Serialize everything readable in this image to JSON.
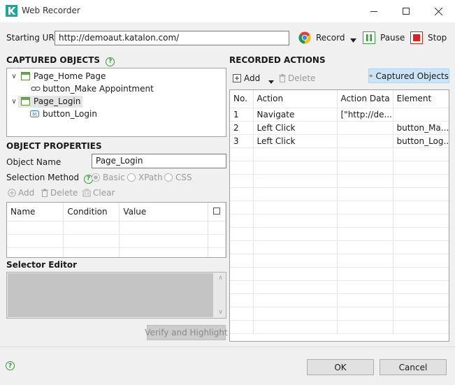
{
  "window": {
    "title": "Web Recorder"
  },
  "url_bar": {
    "label": "Starting URL",
    "value": "http://demoaut.katalon.com/"
  },
  "toolbar": {
    "record_label": "Record",
    "pause_label": "Pause",
    "stop_label": "Stop"
  },
  "captured_objects": {
    "title": "CAPTURED OBJECTS",
    "tree": [
      {
        "label": "Page_Home Page",
        "children": [
          {
            "label": "button_Make Appointment"
          }
        ]
      },
      {
        "label": "Page_Login",
        "children": [
          {
            "label": "button_Login"
          }
        ]
      }
    ]
  },
  "object_properties": {
    "title": "OBJECT PROPERTIES",
    "name_label": "Object Name",
    "name_value": "Page_Login",
    "selection_label": "Selection Method",
    "methods": [
      "Basic",
      "XPath",
      "CSS"
    ],
    "add_label": "Add",
    "delete_label": "Delete",
    "clear_label": "Clear",
    "columns": [
      "Name",
      "Condition",
      "Value"
    ]
  },
  "selector_editor": {
    "title": "Selector Editor",
    "verify_label": "Verify and Highlight"
  },
  "recorded_actions": {
    "title": "RECORDED ACTIONS",
    "add_label": "Add",
    "delete_label": "Delete",
    "captured_toggle_label": "Captured Objects",
    "columns": [
      "No.",
      "Action",
      "Action Data",
      "Element"
    ],
    "rows": [
      {
        "no": "1",
        "action": "Navigate",
        "data": "[\"http://de...",
        "element": ""
      },
      {
        "no": "2",
        "action": "Left Click",
        "data": "",
        "element": "button_Ma..."
      },
      {
        "no": "3",
        "action": "Left Click",
        "data": "",
        "element": "button_Log..."
      }
    ]
  },
  "footer": {
    "ok_label": "OK",
    "cancel_label": "Cancel"
  }
}
